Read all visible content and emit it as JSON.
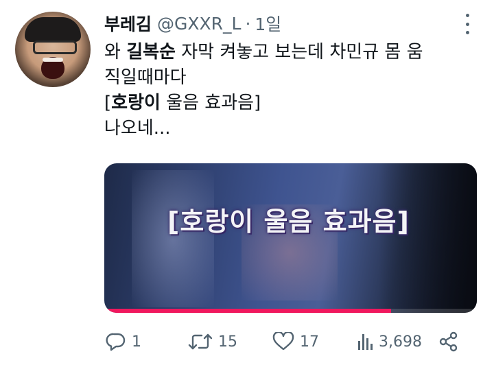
{
  "tweet": {
    "author_name": "부레김",
    "author_handle": "@GXXR_L",
    "separator": "·",
    "time": "1일",
    "body_lines": [
      [
        {
          "text": "와 ",
          "bold": false
        },
        {
          "text": "길복순",
          "bold": true
        },
        {
          "text": " 자막 켜놓고 보는데 차민규 몸 움",
          "bold": false
        }
      ],
      [
        {
          "text": "직일때마다",
          "bold": false
        }
      ],
      [
        {
          "text": "[",
          "bold": false
        },
        {
          "text": "호랑이",
          "bold": true
        },
        {
          "text": " 울음 효과음]",
          "bold": false
        }
      ],
      [
        {
          "text": "나오네...",
          "bold": false
        }
      ]
    ],
    "media": {
      "caption": "[호랑이 울음 효과음]",
      "progress": 0.77
    },
    "actions": {
      "replies": "1",
      "retweets": "15",
      "likes": "17",
      "views": "3,698"
    }
  },
  "icons": [
    "more-icon",
    "reply-icon",
    "retweet-icon",
    "like-icon",
    "views-icon",
    "share-icon"
  ],
  "colors": {
    "muted": "#536471",
    "text": "#0f1419",
    "progress": "#f0185e"
  }
}
